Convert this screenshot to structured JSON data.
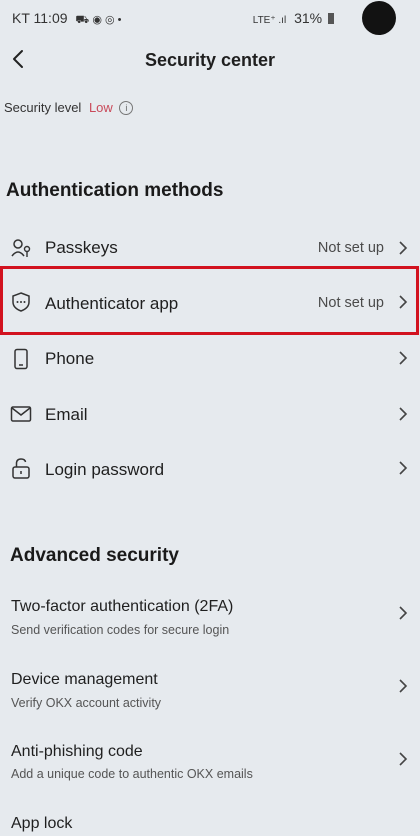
{
  "status_bar": {
    "carrier_time": "KT 11:09",
    "notification_icons": "⛟ ◉ ◎ •",
    "network": "LTE⁺ .ıl",
    "battery": "31%"
  },
  "header": {
    "title": "Security center"
  },
  "security_level": {
    "label": "Security level",
    "value": "Low",
    "info_glyph": "i"
  },
  "auth": {
    "heading": "Authentication methods",
    "items": [
      {
        "label": "Passkeys",
        "status": "Not set up",
        "icon": "passkey-icon"
      },
      {
        "label": "Authenticator app",
        "status": "Not set up",
        "icon": "shield-icon"
      },
      {
        "label": "Phone",
        "status": "",
        "icon": "phone-icon"
      },
      {
        "label": "Email",
        "status": "",
        "icon": "mail-icon"
      },
      {
        "label": "Login password",
        "status": "",
        "icon": "lock-icon"
      }
    ]
  },
  "advanced": {
    "heading": "Advanced security",
    "items": [
      {
        "title": "Two-factor authentication (2FA)",
        "desc": "Send verification codes for secure login"
      },
      {
        "title": "Device management",
        "desc": "Verify OKX account activity"
      },
      {
        "title": "Anti-phishing code",
        "desc": "Add a unique code to authentic OKX emails"
      },
      {
        "title": "App lock",
        "desc": ""
      }
    ]
  },
  "colors": {
    "background": "#e6eaee",
    "highlight": "#d2121f",
    "low": "#c94a5a"
  }
}
